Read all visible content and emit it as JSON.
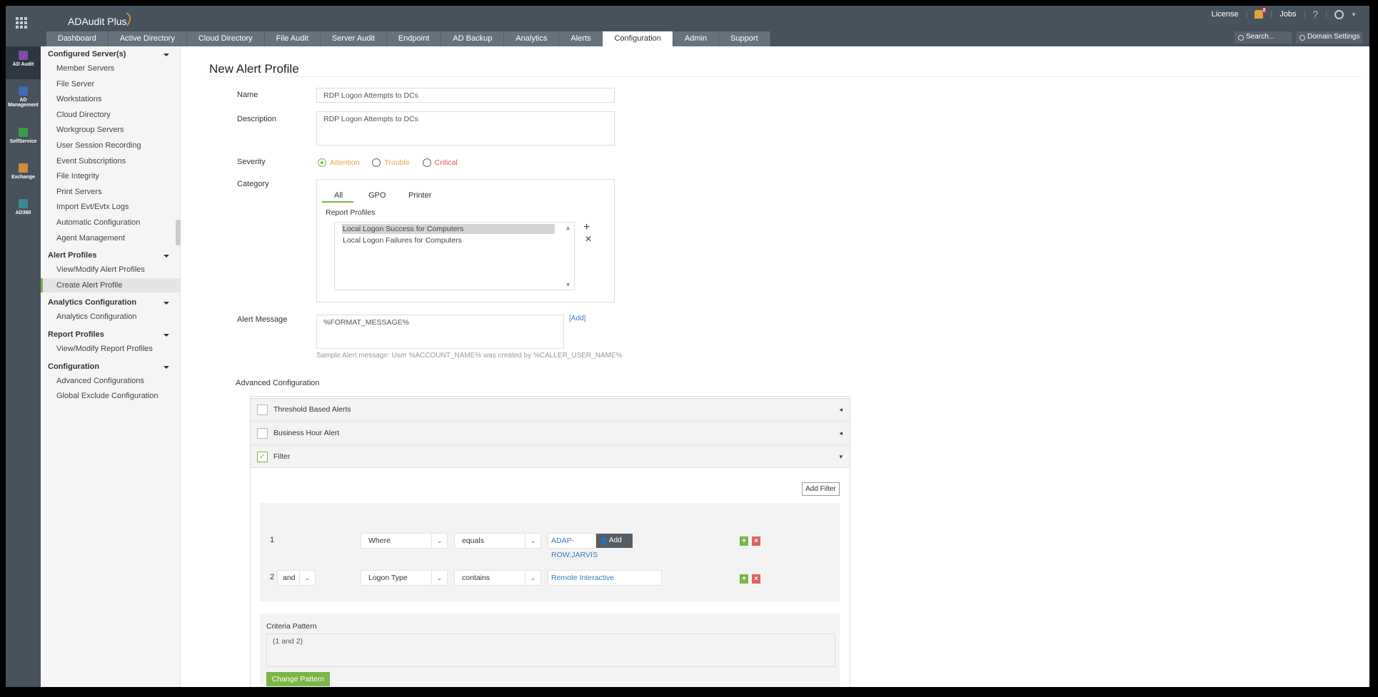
{
  "app": {
    "name": "ADAudit Plus"
  },
  "topbar": {
    "license": "License",
    "alerts_count": "2",
    "jobs": "Jobs",
    "help": "?",
    "search_placeholder": "Search...",
    "domain_settings": "Domain Settings"
  },
  "tabs": [
    "Dashboard",
    "Active Directory",
    "Cloud Directory",
    "File Audit",
    "Server Audit",
    "Endpoint",
    "AD Backup",
    "Analytics",
    "Alerts",
    "Configuration",
    "Admin",
    "Support"
  ],
  "active_tab": "Configuration",
  "rail": [
    "AD Audit",
    "AD Management",
    "SelfService",
    "Exchange",
    "AD360"
  ],
  "sidebar": {
    "sections": [
      {
        "title": "Configured Server(s)",
        "items": [
          "Member Servers",
          "File Server",
          "Workstations",
          "Cloud Directory",
          "Workgroup Servers",
          "User Session Recording",
          "Event Subscriptions",
          "File Integrity",
          "Print Servers",
          "Import Evt/Evtx Logs",
          "Automatic Configuration",
          "Agent Management"
        ]
      },
      {
        "title": "Alert Profiles",
        "items": [
          "View/Modify Alert Profiles",
          "Create Alert Profile"
        ]
      },
      {
        "title": "Analytics Configuration",
        "items": [
          "Analytics Configuration"
        ]
      },
      {
        "title": "Report Profiles",
        "items": [
          "View/Modify Report Profiles"
        ]
      },
      {
        "title": "Configuration",
        "items": [
          "Advanced Configurations",
          "Global Exclude Configuration"
        ]
      }
    ],
    "active_item": "Create Alert Profile"
  },
  "form": {
    "title": "New Alert Profile",
    "name_label": "Name",
    "name_value": "RDP Logon Attempts to DCs",
    "description_label": "Description",
    "description_value": "RDP Logon Attempts to DCs",
    "severity_label": "Severity",
    "severity": [
      {
        "label": "Attention",
        "color": "#e8a33c",
        "selected": true
      },
      {
        "label": "Trouble",
        "color": "#e8a33c",
        "selected": false
      },
      {
        "label": "Critical",
        "color": "#d9534f",
        "selected": false
      }
    ],
    "category_label": "Category",
    "category_tabs": [
      "All",
      "GPO",
      "Printer"
    ],
    "report_profiles_label": "Report Profiles",
    "report_profiles": [
      "Local Logon Success for Computers",
      "Local Logon Failures for Computers"
    ],
    "alert_message_label": "Alert Message",
    "alert_message_value": "%FORMAT_MESSAGE%",
    "add_link": "[Add]",
    "sample_message": "Sample Alert message: User %ACCOUNT_NAME% was created by %CALLER_USER_NAME%",
    "advanced_label": "Advanced Configuration",
    "accordions": [
      {
        "label": "Threshold Based Alerts",
        "checked": false
      },
      {
        "label": "Business Hour Alert",
        "checked": false
      },
      {
        "label": "Filter",
        "checked": true
      }
    ],
    "add_filter": "Add Filter",
    "filters": [
      {
        "num": "1",
        "join": "",
        "field": "Where",
        "op": "equals",
        "value": "ADAP-ROW;JARVIS",
        "add": "Add"
      },
      {
        "num": "2",
        "join": "and",
        "field": "Logon Type",
        "op": "contains",
        "value": "Remote Interactive"
      }
    ],
    "criteria_label": "Criteria Pattern",
    "criteria_value": "(1 and 2)",
    "change_pattern": "Change Pattern"
  },
  "colors": {
    "header": "#47525c",
    "accent": "#7ab648"
  }
}
